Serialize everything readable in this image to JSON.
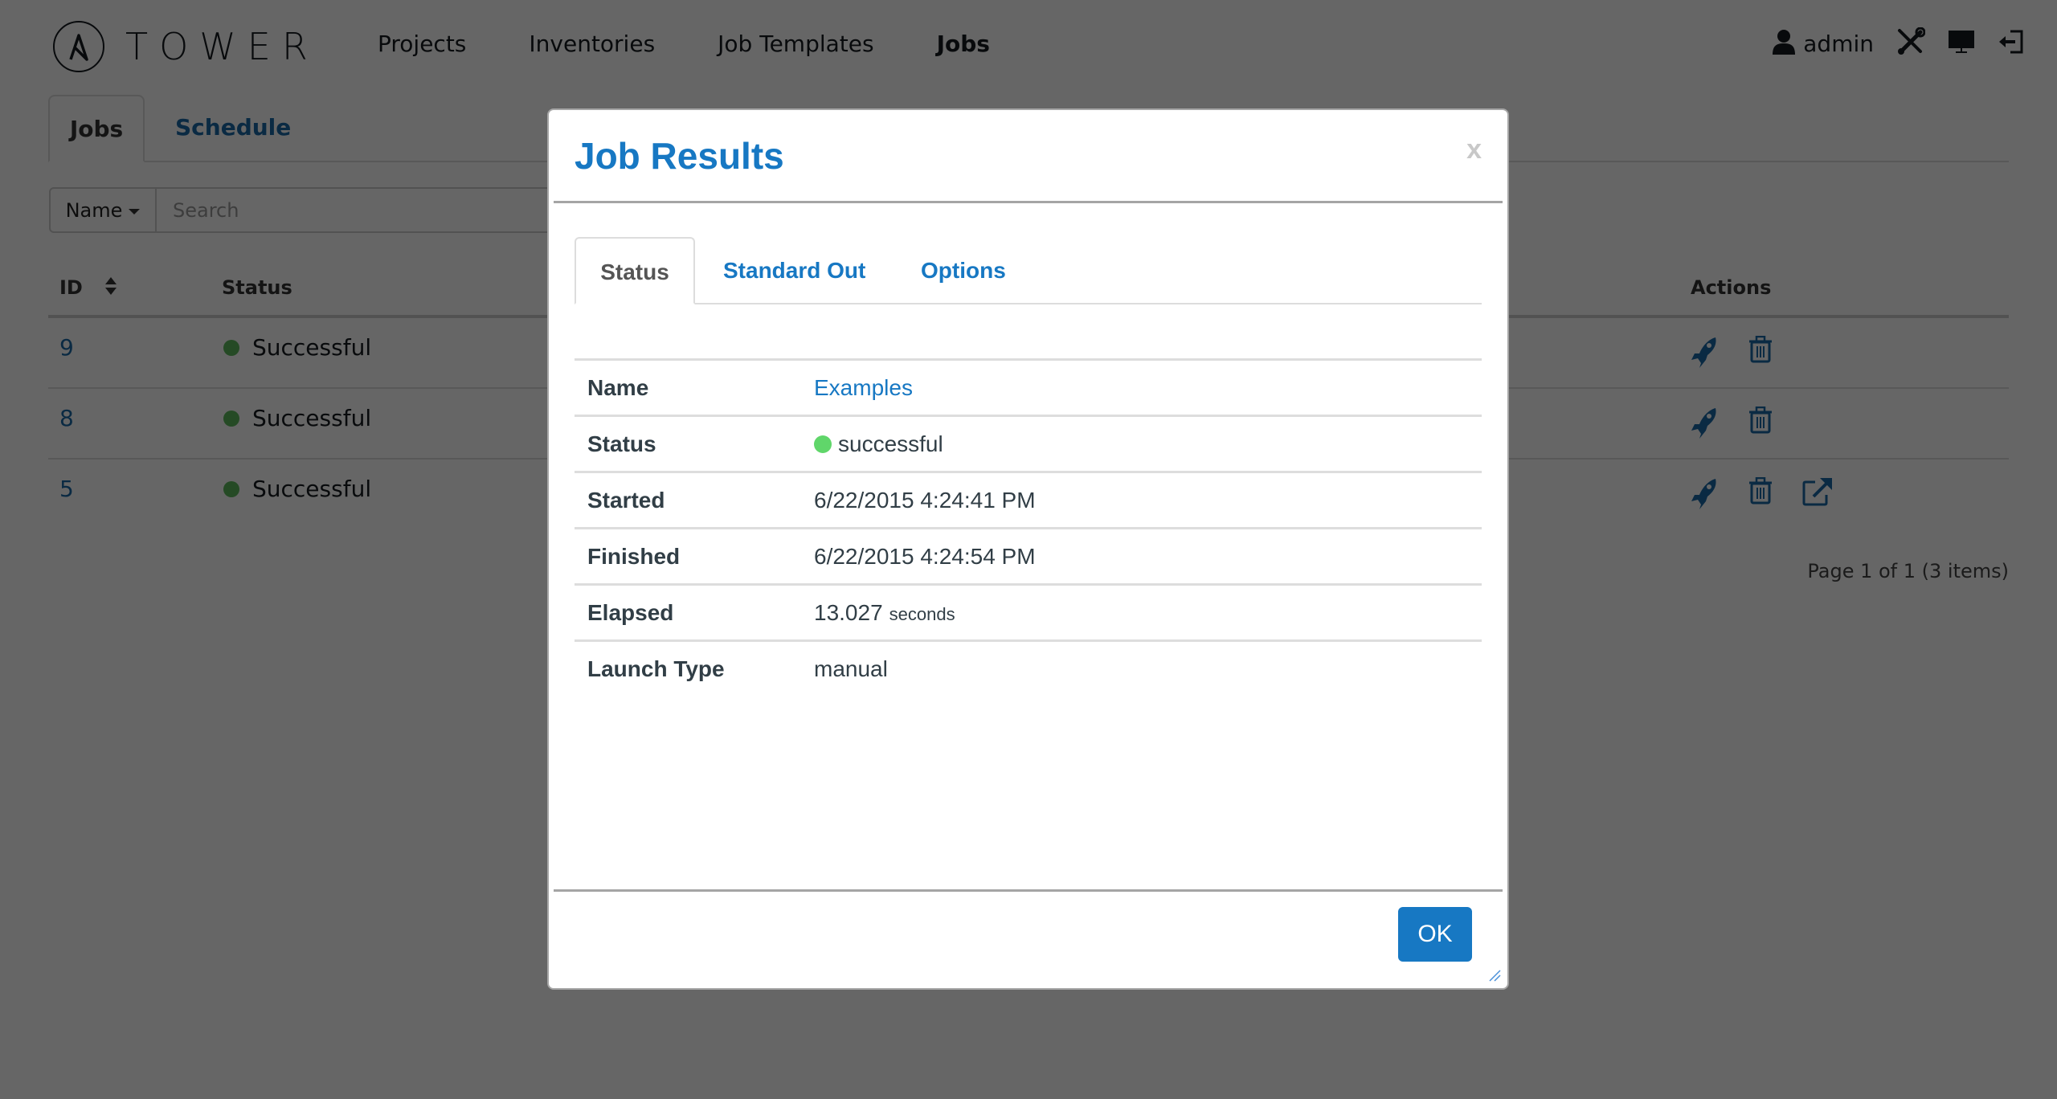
{
  "app": {
    "brand": "TOWER",
    "nav": [
      "Projects",
      "Inventories",
      "Job Templates",
      "Jobs"
    ],
    "active_nav": "Jobs",
    "user": "admin",
    "header_icons": [
      "user-icon",
      "wrench-screwdriver-icon",
      "monitor-icon",
      "logout-icon"
    ]
  },
  "page": {
    "tabs": [
      {
        "label": "Jobs",
        "active": true
      },
      {
        "label": "Schedule",
        "active": false
      }
    ],
    "search": {
      "field_selector": "Name",
      "placeholder": "Search",
      "value": ""
    },
    "table": {
      "columns": [
        "ID",
        "Status",
        "Actions"
      ],
      "rows": [
        {
          "id": "9",
          "status": "Successful",
          "actions": [
            "relaunch",
            "delete"
          ]
        },
        {
          "id": "8",
          "status": "Successful",
          "actions": [
            "relaunch",
            "delete"
          ]
        },
        {
          "id": "5",
          "status": "Successful",
          "actions": [
            "relaunch",
            "delete",
            "view-details"
          ]
        }
      ]
    },
    "pagination": "Page 1 of 1 (3 items)"
  },
  "modal": {
    "title": "Job Results",
    "close_label": "x",
    "tabs": [
      {
        "label": "Status",
        "active": true
      },
      {
        "label": "Standard Out",
        "active": false
      },
      {
        "label": "Options",
        "active": false
      }
    ],
    "fields": [
      {
        "label": "Name",
        "value": "Examples",
        "link": true
      },
      {
        "label": "Status",
        "value": "successful",
        "status_dot": true
      },
      {
        "label": "Started",
        "value": "6/22/2015 4:24:41 PM"
      },
      {
        "label": "Finished",
        "value": "6/22/2015 4:24:54 PM"
      },
      {
        "label": "Elapsed",
        "value": "13.027",
        "unit": "seconds"
      },
      {
        "label": "Launch Type",
        "value": "manual"
      }
    ],
    "ok_label": "OK"
  },
  "colors": {
    "brand_blue": "#1778c3",
    "link_blue": "#1a6aa8",
    "success_green": "#5cb85c",
    "status_dot_green": "#60d66a",
    "overlay": "rgba(0,0,0,0.6)"
  }
}
